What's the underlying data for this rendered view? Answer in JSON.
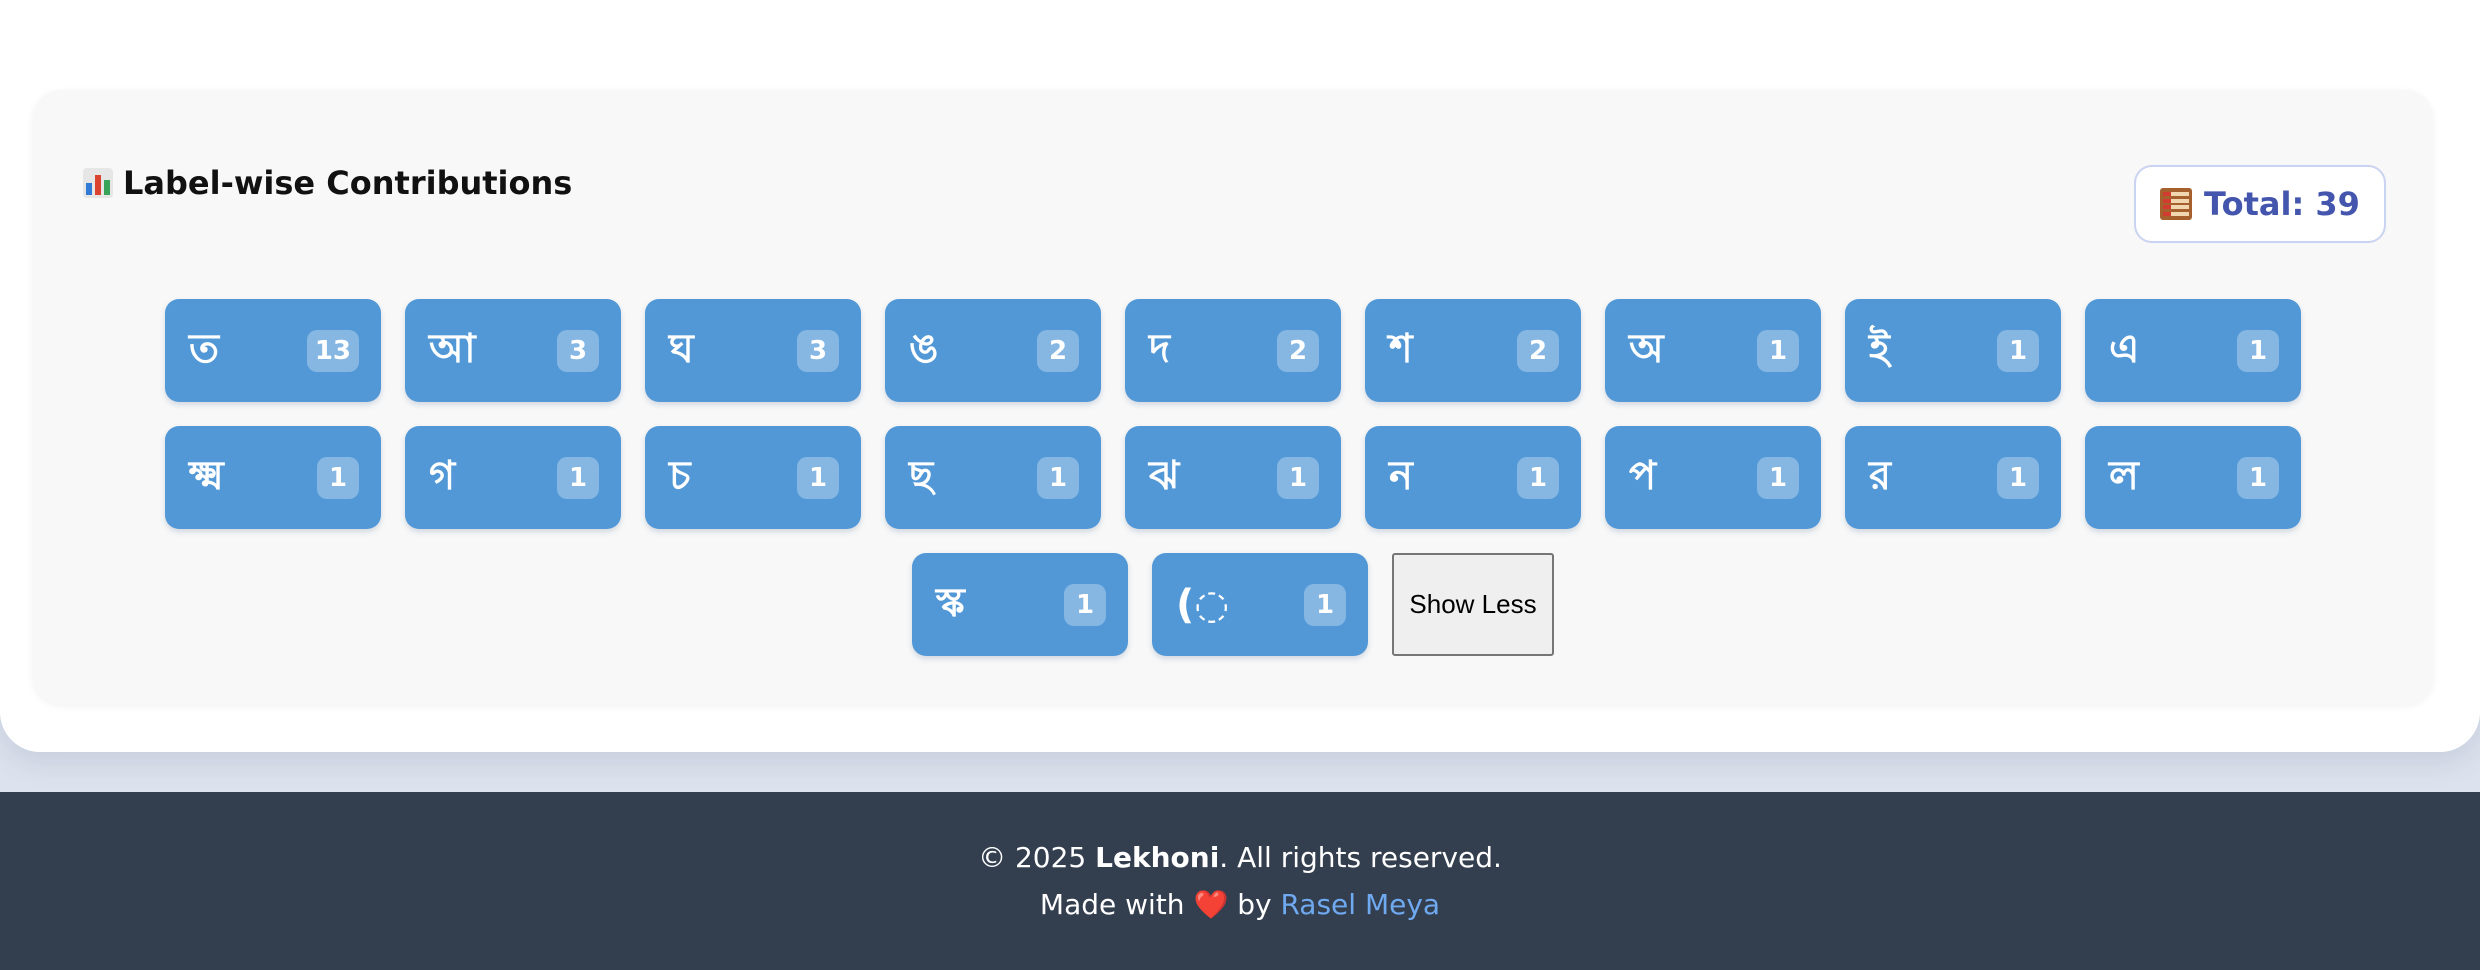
{
  "panel": {
    "title": "Label-wise Contributions",
    "title_icon": "bar-chart-icon",
    "total_icon": "abacus-icon",
    "total_text": "Total: 39"
  },
  "labels": {
    "row1": [
      {
        "label": "ত",
        "count": "13"
      },
      {
        "label": "আ",
        "count": "3"
      },
      {
        "label": "ঘ",
        "count": "3"
      },
      {
        "label": "ঙ",
        "count": "2"
      },
      {
        "label": "দ",
        "count": "2"
      },
      {
        "label": "শ",
        "count": "2"
      },
      {
        "label": "অ",
        "count": "1"
      },
      {
        "label": "ই",
        "count": "1"
      },
      {
        "label": "এ",
        "count": "1"
      }
    ],
    "row2": [
      {
        "label": "ক্ষ্ম",
        "count": "1"
      },
      {
        "label": "গ",
        "count": "1"
      },
      {
        "label": "চ",
        "count": "1"
      },
      {
        "label": "ছ",
        "count": "1"
      },
      {
        "label": "ঝ",
        "count": "1"
      },
      {
        "label": "ন",
        "count": "1"
      },
      {
        "label": "প",
        "count": "1"
      },
      {
        "label": "র",
        "count": "1"
      },
      {
        "label": "ল",
        "count": "1"
      }
    ],
    "row3": [
      {
        "label": "স্ক",
        "count": "1"
      },
      {
        "label": "(◌",
        "count": "1"
      }
    ]
  },
  "show_less_label": "Show Less",
  "footer": {
    "copyright_prefix": "© 2025 ",
    "brand": "Lekhoni",
    "copyright_suffix": ". All rights reserved.",
    "made_with_prefix": "Made with ",
    "heart": "❤️",
    "by_text": " by ",
    "author": "Rasel Meya"
  },
  "colors": {
    "chip_bg": "#5298d7",
    "total_text": "#4355ad",
    "footer_bg": "#333e4f",
    "author_link": "#6fa9f0"
  }
}
